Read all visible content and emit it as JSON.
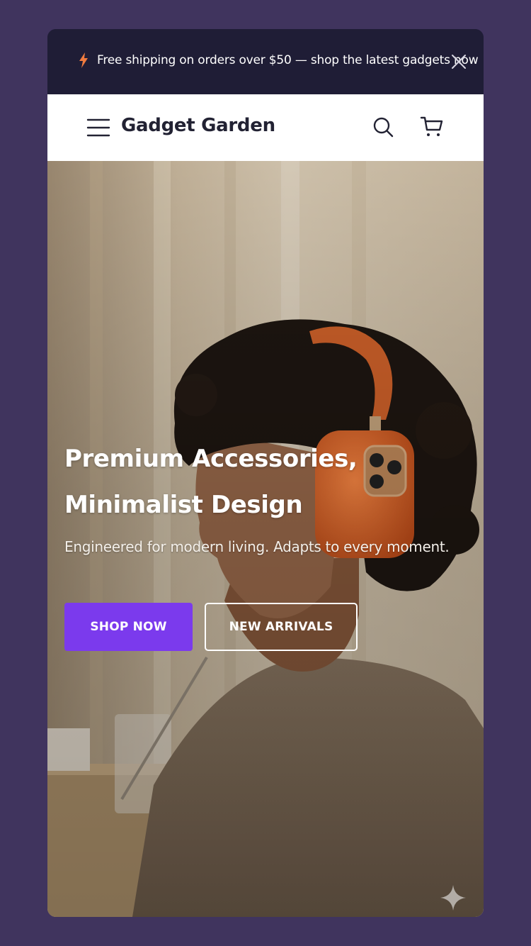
{
  "announcement": {
    "text": "Free shipping on orders over $50 — shop the latest gadgets now",
    "icon": "lightning-bolt-icon",
    "close_icon": "close-icon",
    "accent_color": "#f07b3f"
  },
  "header": {
    "menu_icon": "hamburger-menu-icon",
    "brand": "Gadget Garden",
    "search_icon": "search-icon",
    "cart_icon": "cart-icon"
  },
  "hero": {
    "title_line1": "Premium Accessories,",
    "title_line2": "Minimalist Design",
    "subtitle": "Engineered for modern living. Adapts to every moment.",
    "primary_button": "SHOP NOW",
    "secondary_button": "NEW ARRIVALS",
    "primary_color": "#7b3aed"
  },
  "colors": {
    "background": "#40345e",
    "announcement_bg": "#1f1d36",
    "header_bg": "#ffffff"
  }
}
